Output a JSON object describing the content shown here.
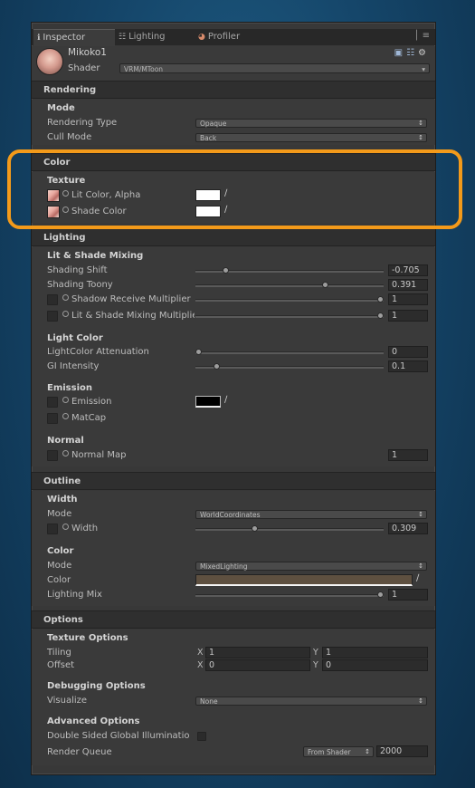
{
  "tabs": [
    {
      "label": "Inspector",
      "icon": "info-icon"
    },
    {
      "label": "Lighting",
      "icon": "lighting-icon"
    },
    {
      "label": "Profiler",
      "icon": "profiler-icon"
    }
  ],
  "header": {
    "object_name": "Mikoko1",
    "shader_label": "Shader",
    "shader_value": "VRM/MToon"
  },
  "rendering": {
    "title": "Rendering",
    "mode_title": "Mode",
    "rendering_type_label": "Rendering Type",
    "rendering_type_value": "Opaque",
    "cull_mode_label": "Cull Mode",
    "cull_mode_value": "Back"
  },
  "color": {
    "title": "Color",
    "texture_title": "Texture",
    "lit_color_label": "Lit Color, Alpha",
    "lit_color": "#ffffff",
    "shade_color_label": "Shade Color",
    "shade_color": "#ffffff"
  },
  "lighting": {
    "title": "Lighting",
    "mixing_title": "Lit & Shade Mixing",
    "shading_shift_label": "Shading Shift",
    "shading_shift_value": "-0.705",
    "shading_toony_label": "Shading Toony",
    "shading_toony_value": "0.391",
    "shadow_receive_label": "Shadow Receive Multiplier",
    "shadow_receive_value": "1",
    "mixing_mult_label": "Lit & Shade Mixing Multiplie",
    "mixing_mult_value": "1",
    "light_color_title": "Light Color",
    "atten_label": "LightColor Attenuation",
    "atten_value": "0",
    "gi_label": "GI Intensity",
    "gi_value": "0.1",
    "emission_title": "Emission",
    "emission_label": "Emission",
    "emission_color": "#000000",
    "matcap_label": "MatCap",
    "normal_title": "Normal",
    "normal_map_label": "Normal Map",
    "normal_map_value": "1"
  },
  "outline": {
    "title": "Outline",
    "width_title": "Width",
    "width_mode_label": "Mode",
    "width_mode_value": "WorldCoordinates",
    "width_label": "Width",
    "width_value": "0.309",
    "color_title": "Color",
    "color_mode_label": "Mode",
    "color_mode_value": "MixedLighting",
    "color_label": "Color",
    "color_value": "#5e5040",
    "lighting_mix_label": "Lighting Mix",
    "lighting_mix_value": "1"
  },
  "options": {
    "title": "Options",
    "texture_options_title": "Texture Options",
    "tiling_label": "Tiling",
    "tiling_x": "1",
    "tiling_y": "1",
    "offset_label": "Offset",
    "offset_x": "0",
    "offset_y": "0",
    "x_label": "X",
    "y_label": "Y",
    "debug_title": "Debugging Options",
    "visualize_label": "Visualize",
    "visualize_value": "None",
    "advanced_title": "Advanced Options",
    "double_sided_label": "Double Sided Global Illuminatio",
    "render_queue_label": "Render Queue",
    "render_queue_source": "From Shader",
    "render_queue_value": "2000"
  },
  "slider_levels": {
    "shading_shift": 0.15,
    "shading_toony": 0.695,
    "shadow_receive": 1.0,
    "mixing_mult": 1.0,
    "atten": 0.0,
    "gi": 0.1,
    "outline_width": 0.309,
    "lighting_mix": 1.0
  },
  "accent": {
    "highlight": "#f39a1a"
  }
}
